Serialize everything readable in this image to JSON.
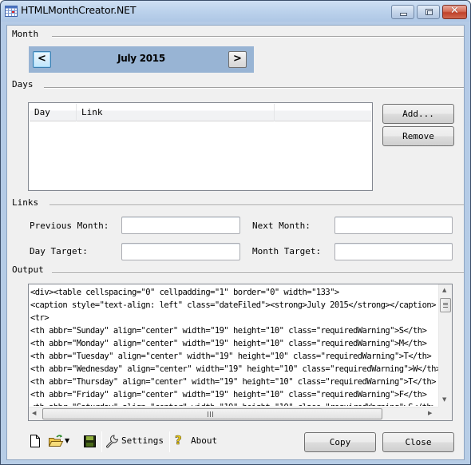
{
  "window": {
    "title": "HTMLMonthCreator.NET",
    "controls": {
      "minimize": "minimize",
      "maximize": "maximize",
      "close": "✕"
    }
  },
  "month_group": {
    "label": "Month",
    "prev_label": "<",
    "current": "July 2015",
    "next_label": ">"
  },
  "days_group": {
    "label": "Days",
    "columns": [
      "Day",
      "Link",
      ""
    ],
    "rows": [],
    "add_label": "Add...",
    "remove_label": "Remove"
  },
  "links_group": {
    "label": "Links",
    "previous_month_label": "Previous Month:",
    "previous_month_value": "",
    "next_month_label": "Next Month:",
    "next_month_value": "",
    "day_target_label": "Day Target:",
    "day_target_value": "",
    "month_target_label": "Month Target:",
    "month_target_value": ""
  },
  "output_group": {
    "label": "Output",
    "text": "<div><table cellspacing=\"0\" cellpadding=\"1\" border=\"0\" width=\"133\">\n<caption style=\"text-align: left\" class=\"dateFiled\"><strong>July 2015</strong></caption>\n<tr>\n<th abbr=\"Sunday\" align=\"center\" width=\"19\" height=\"10\" class=\"requiredWarning\">S</th>\n<th abbr=\"Monday\" align=\"center\" width=\"19\" height=\"10\" class=\"requiredWarning\">M</th>\n<th abbr=\"Tuesday\" align=\"center\" width=\"19\" height=\"10\" class=\"requiredWarning\">T</th>\n<th abbr=\"Wednesday\" align=\"center\" width=\"19\" height=\"10\" class=\"requiredWarning\">W</th>\n<th abbr=\"Thursday\" align=\"center\" width=\"19\" height=\"10\" class=\"requiredWarning\">T</th>\n<th abbr=\"Friday\" align=\"center\" width=\"19\" height=\"10\" class=\"requiredWarning\">F</th>\n<th abbr=\"Saturday\" align=\"center\" width=\"19\" height=\"10\" class=\"requiredWarning\">S</th>"
  },
  "toolbar": {
    "new_icon": "new-document-icon",
    "open_icon": "open-folder-icon",
    "save_icon": "save-disk-icon",
    "settings_label": "Settings",
    "about_label": "About"
  },
  "footer": {
    "copy_label": "Copy",
    "close_label": "Close"
  }
}
